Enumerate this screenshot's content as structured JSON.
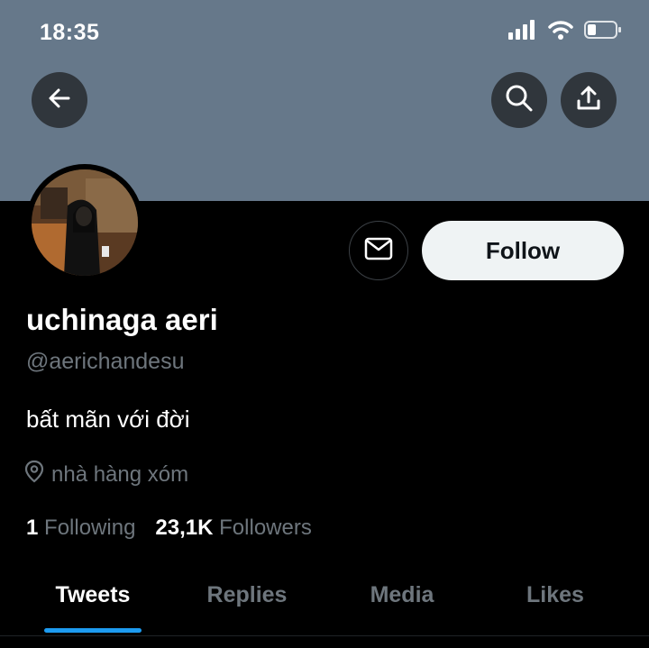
{
  "status_bar": {
    "time": "18:35"
  },
  "profile": {
    "display_name": "uchinaga aeri",
    "handle": "@aerichandesu",
    "bio": "bất mãn với đời",
    "location": "nhà hàng xóm",
    "following_count": "1",
    "following_label": "Following",
    "followers_count": "23,1K",
    "followers_label": "Followers"
  },
  "actions": {
    "follow_label": "Follow"
  },
  "tabs": [
    {
      "label": "Tweets",
      "active": true
    },
    {
      "label": "Replies",
      "active": false
    },
    {
      "label": "Media",
      "active": false
    },
    {
      "label": "Likes",
      "active": false
    }
  ],
  "colors": {
    "banner": "#66788a",
    "accent": "#1d9bf0",
    "background": "#000000",
    "muted_text": "#6e767d"
  },
  "icons": [
    "back-arrow-icon",
    "search-icon",
    "share-icon",
    "mail-icon",
    "location-pin-icon",
    "signal-icon",
    "wifi-icon",
    "battery-icon"
  ]
}
